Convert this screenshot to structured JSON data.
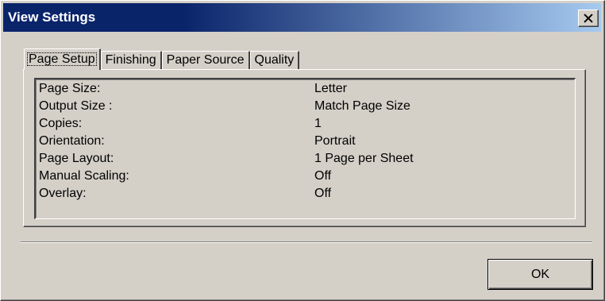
{
  "window": {
    "title": "View Settings",
    "close_icon": "close-icon"
  },
  "tabs": [
    {
      "label": "Page Setup",
      "active": true
    },
    {
      "label": "Finishing",
      "active": false
    },
    {
      "label": "Paper Source",
      "active": false
    },
    {
      "label": "Quality",
      "active": false
    }
  ],
  "settings": [
    {
      "label": "Page Size:",
      "value": "Letter"
    },
    {
      "label": "Output Size :",
      "value": "Match Page Size"
    },
    {
      "label": "Copies:",
      "value": "1"
    },
    {
      "label": "Orientation:",
      "value": "Portrait"
    },
    {
      "label": "Page Layout:",
      "value": "1 Page per Sheet"
    },
    {
      "label": "Manual Scaling:",
      "value": "Off"
    },
    {
      "label": "Overlay:",
      "value": "Off"
    }
  ],
  "buttons": {
    "ok_label": "OK"
  },
  "colors": {
    "title_bar_start": "#0a246a",
    "title_bar_end": "#a6caf0",
    "face": "#d4d0c8"
  }
}
